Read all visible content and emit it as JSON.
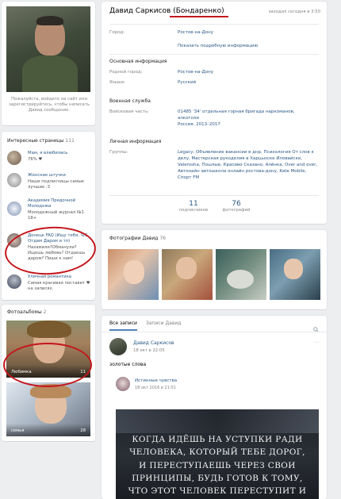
{
  "left": {
    "login_text": "Пожалуйста, войдите на сайт или зарегистрируйтесь, чтобы написать Давид сообщение.",
    "interesting_label": "Интересные страницы",
    "interesting_count": "111",
    "pages": [
      {
        "name": "Мам, я влюбилась",
        "desc": "76% ♥"
      },
      {
        "name": "Женские штучки",
        "desc": "Наши подписчицы самые лучшие :3"
      },
      {
        "name": "Академия Прядочной Молодежи",
        "desc": "Молодежный журнал №1 18+"
      },
      {
        "name": "Донецк FAQ (Ищу тебя, Ч/С, Отдам Даром и тп)",
        "desc": "Нахамили?Обманули? Ищешь любовь? Отдаешь даром? Пиши к нам!"
      },
      {
        "name": "Уличная романтика",
        "desc": "Самая красивая поставит ♥ на записях."
      }
    ],
    "albums_label": "Фотоальбомы",
    "albums_count": "2",
    "albums": [
      {
        "name": "Любимка",
        "count": "11"
      },
      {
        "name": "семья",
        "count": "28"
      }
    ]
  },
  "profile": {
    "name": "Давид Саркисов",
    "maiden": "(Бондаренко)",
    "last_seen": "заходил сегодня в 3:50",
    "city_label": "Город:",
    "city": "Ростов-на-Дону",
    "show_more": "Показать подробную информацию",
    "main_info": "Основная информация",
    "home_label": "Родной город:",
    "home": "Ростов-на-Дону",
    "lang_label": "Языки:",
    "lang": "Русский",
    "military": "Военная служба",
    "unit_label": "Войсковая часть:",
    "unit": "01485 '34' отдельная горная бригада наркоманов, алкоголи",
    "unit_years": "Россия, 2013–2017",
    "personal": "Личная информация",
    "groups_label": "Группы:",
    "groups": "Legacy, Объявление вакансии в днр, Психология От слов к делу, Мастерская рукоделия в Харцызске Иловайске, Valerosha, Пошлые, Красиво Сказано, Алёнка, Over and over, Автонайн автошкола онлайн ростова-дону, Kate Mobile, Спорт FM",
    "stats": [
      {
        "num": "11",
        "label": "подписчиков"
      },
      {
        "num": "76",
        "label": "фотографий"
      }
    ]
  },
  "photos": {
    "label": "Фотографии Давид",
    "count": "76"
  },
  "wall": {
    "tab_all": "Все записи",
    "tab_own": "Записи Давид",
    "author": "Давид Саркисов",
    "date": "18 окт в 22:05",
    "text": "золотые слова",
    "repost_author": "Истинные чувства",
    "repost_date": "18 окт 2016 в 21:01",
    "quote": "Когда идёшь на уступки ради человека, который тебе дорог, и переступаешь через свои принципы, будь готов к тому, что этот человек переступит и через тебя, так как мало"
  },
  "colors": {
    "accent": "#2a5885",
    "annotation": "#c4161c",
    "background": "#edeef0"
  }
}
